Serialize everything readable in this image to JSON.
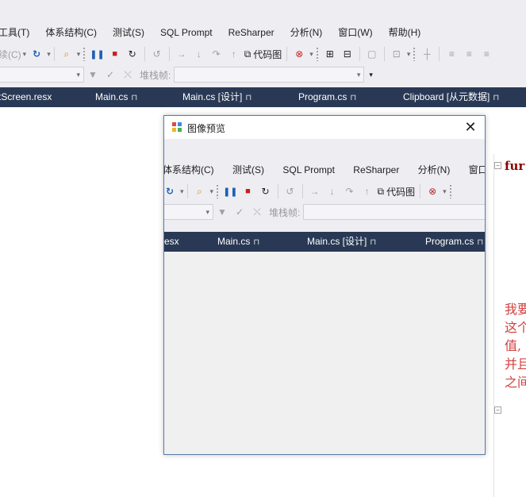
{
  "menu": [
    "工具(T)",
    "体系结构(C)",
    "测试(S)",
    "SQL Prompt",
    "ReSharper",
    "分析(N)",
    "窗口(W)",
    "帮助(H)"
  ],
  "toolbar": {
    "continue_label": "续(C)",
    "codemap_label": "代码图",
    "stack_frame_label": "堆栈帧:"
  },
  "tabs": [
    {
      "label": "tScreen.resx"
    },
    {
      "label": "Main.cs"
    },
    {
      "label": "Main.cs [设计]"
    },
    {
      "label": "Program.cs"
    },
    {
      "label": "Clipboard [从元数据]"
    }
  ],
  "editor": {
    "code_line": "fur",
    "comment_lines": [
      "我要",
      "这个",
      "值,",
      "并且",
      "之间"
    ]
  },
  "dialog": {
    "title": "图像预览",
    "close_glyph": "✕",
    "preview": {
      "menu": [
        "体系结构(C)",
        "测试(S)",
        "SQL Prompt",
        "ReSharper",
        "分析(N)",
        "窗口"
      ],
      "codemap_label": "代码图",
      "stack_frame_label": "堆栈帧:",
      "tabs": [
        {
          "label": "esx"
        },
        {
          "label": "Main.cs"
        },
        {
          "label": "Main.cs [设计]"
        },
        {
          "label": "Program.cs"
        }
      ]
    }
  },
  "colors": {
    "tab_bar": "#293955",
    "menu_bg": "#eeeef2",
    "comment": "#d24040",
    "keyword": "#8b0000"
  }
}
